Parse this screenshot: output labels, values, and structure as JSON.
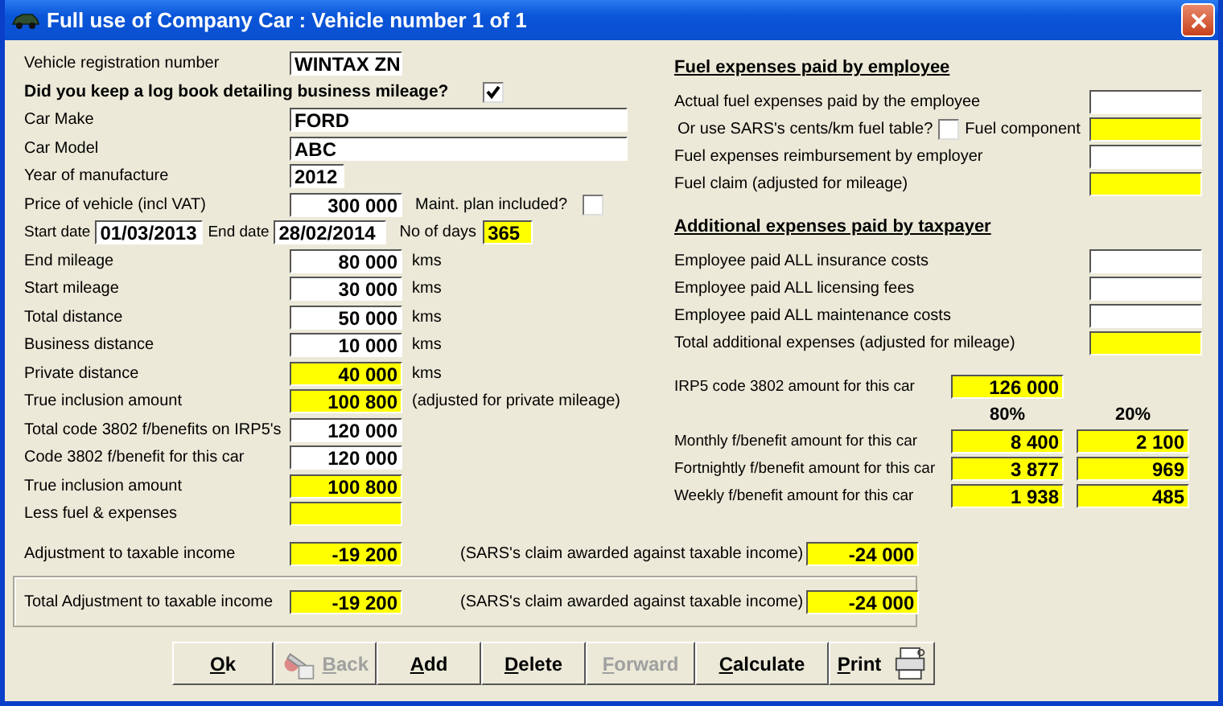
{
  "window": {
    "title": "Full use of Company Car :  Vehicle number 1 of 1"
  },
  "vehicle": {
    "registration": {
      "label": "Vehicle registration number",
      "value": "WINTAX ZN",
      "computed": false
    },
    "logbook": {
      "label": "Did you keep a log book detailing business mileage?",
      "checked": true
    },
    "make": {
      "label": "Car Make",
      "value": "FORD",
      "computed": false
    },
    "model": {
      "label": "Car Model",
      "value": "ABC",
      "computed": false
    },
    "year": {
      "label": "Year of manufacture",
      "value": "2012",
      "computed": false
    },
    "price": {
      "label": "Price of vehicle (incl VAT)",
      "value": "300 000",
      "computed": false
    },
    "maint_plan": {
      "label": "Maint. plan included?",
      "checked": false
    },
    "start_date": {
      "label": "Start date",
      "value": "01/03/2013",
      "computed": false
    },
    "end_date": {
      "label": "End date",
      "value": "28/02/2014",
      "computed": false
    },
    "days": {
      "label": "No of days",
      "value": "365",
      "computed": true
    }
  },
  "amounts": [
    {
      "label": "End mileage",
      "value": "80 000",
      "computed": false,
      "unit": "kms"
    },
    {
      "label": "Start mileage",
      "value": "30 000",
      "computed": false,
      "unit": "kms"
    },
    {
      "label": "Total distance",
      "value": "50 000",
      "computed": false,
      "unit": "kms"
    },
    {
      "label": "Business distance",
      "value": "10 000",
      "computed": false,
      "unit": "kms"
    },
    {
      "label": "Private distance",
      "value": "40 000",
      "computed": true,
      "unit": "kms"
    },
    {
      "label": "True inclusion amount",
      "value": "100 800",
      "computed": true,
      "unit": "(adjusted for private mileage)"
    },
    {
      "label": "Total code 3802 f/benefits on IRP5's",
      "value": "120 000",
      "computed": false
    },
    {
      "label": "Code 3802 f/benefit for this car",
      "value": "120 000",
      "computed": false
    },
    {
      "label": "True inclusion amount",
      "value": "100 800",
      "computed": true
    },
    {
      "label": "Less fuel & expenses",
      "computed": true
    }
  ],
  "adjustment": {
    "label": "Adjustment to taxable income",
    "value": "-19 200",
    "computed": true,
    "sars_label": "(SARS's claim awarded against taxable income)",
    "sars_value": "-24 000"
  },
  "total_adjustment": {
    "label": "Total Adjustment to taxable income",
    "value": "-19 200",
    "computed": true,
    "sars_label": "(SARS's claim awarded against taxable income)",
    "sars_value": "-24 000"
  },
  "fuel": {
    "heading": "Fuel expenses paid by employee",
    "rows": [
      {
        "kind": "plain",
        "label": "Actual fuel expenses paid by the employee",
        "computed": false
      },
      {
        "kind": "option",
        "label": "Or use SARS's cents/km fuel table?",
        "checked": false,
        "field_label": "Fuel component",
        "computed": true
      },
      {
        "kind": "plain",
        "label": "Fuel expenses reimbursement by employer",
        "computed": false
      },
      {
        "kind": "plain",
        "label": "Fuel claim (adjusted for mileage)",
        "computed": true
      }
    ]
  },
  "additional": {
    "heading": "Additional expenses paid by taxpayer",
    "rows": [
      {
        "kind": "plain",
        "label": "Employee paid ALL insurance costs",
        "computed": false
      },
      {
        "kind": "plain",
        "label": "Employee paid ALL licensing fees",
        "computed": false
      },
      {
        "kind": "plain",
        "label": "Employee paid ALL maintenance costs",
        "computed": false
      },
      {
        "kind": "plain",
        "label": "Total additional expenses (adjusted for mileage)",
        "computed": true
      }
    ]
  },
  "irp5": {
    "label": "IRP5 code 3802 amount for this car",
    "value": "126 000",
    "computed": true
  },
  "benefits": {
    "columns": [
      "80%",
      "20%"
    ],
    "rows": [
      {
        "label": "Monthly f/benefit amount for this car",
        "values": [
          "8 400",
          "2 100"
        ]
      },
      {
        "label": "Fortnightly f/benefit amount for this car",
        "values": [
          "3 877",
          "969"
        ]
      },
      {
        "label": "Weekly f/benefit amount for this car",
        "values": [
          "1 938",
          "485"
        ]
      }
    ]
  },
  "buttons": [
    {
      "label": "Ok",
      "disabled": false
    },
    {
      "label": "Back",
      "disabled": true
    },
    {
      "label": "Add",
      "disabled": false
    },
    {
      "label": "Delete",
      "disabled": false
    },
    {
      "label": "Forward",
      "disabled": true
    },
    {
      "label": "Calculate",
      "disabled": false
    },
    {
      "label": "Print",
      "disabled": false
    }
  ]
}
